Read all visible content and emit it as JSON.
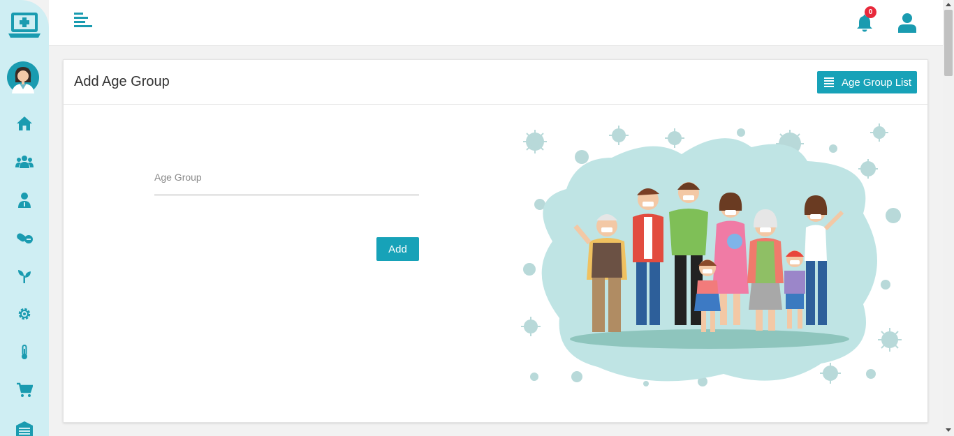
{
  "sidebar": {
    "logo": "medical-laptop-logo",
    "avatar": "doctor-avatar",
    "items": [
      {
        "icon": "home-icon"
      },
      {
        "icon": "users-icon"
      },
      {
        "icon": "doctor-icon"
      },
      {
        "icon": "pills-icon"
      },
      {
        "icon": "seedling-icon"
      },
      {
        "icon": "gear-icon"
      },
      {
        "icon": "thermometer-icon"
      },
      {
        "icon": "cart-icon"
      },
      {
        "icon": "warehouse-icon"
      }
    ]
  },
  "topbar": {
    "menu_icon": "menu-toggle-icon",
    "notification_count": "0",
    "user_icon": "user-icon"
  },
  "card": {
    "title": "Add Age Group",
    "list_button_label": "Age Group List",
    "list_button_icon": "list-icon"
  },
  "form": {
    "age_group": {
      "label": "Age Group",
      "value": ""
    },
    "submit_label": "Add"
  },
  "illustration": "family-with-masks-illustration",
  "colors": {
    "accent": "#17a2b8",
    "sidebar_bg": "#cfeef3",
    "badge": "#e8293b",
    "blob": "#bfe4e4"
  }
}
